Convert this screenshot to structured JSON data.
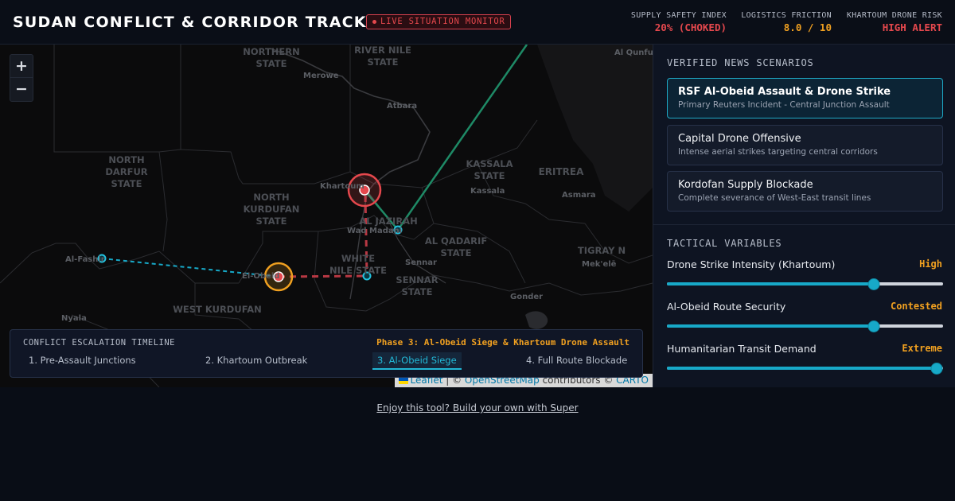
{
  "header": {
    "title": "SUDAN CONFLICT & CORRIDOR TRACKER",
    "badge": "LIVE SITUATION MONITOR",
    "metrics": [
      {
        "label": "SUPPLY SAFETY INDEX",
        "value": "20% (CHOKED)",
        "color": "#e5484d"
      },
      {
        "label": "LOGISTICS FRICTION",
        "value": "8.0 / 10",
        "color": "#f0a020"
      },
      {
        "label": "KHARTOUM DRONE RISK",
        "value": "HIGH ALERT",
        "color": "#e5484d"
      }
    ]
  },
  "map": {
    "zoom_in": "+",
    "zoom_out": "−",
    "region_labels": [
      "NORTHERN STATE",
      "RIVER NILE STATE",
      "NORTH DARFUR STATE",
      "NORTH KURDUFAN STATE",
      "KASSALA STATE",
      "ERITREA",
      "AL JAZIRAH",
      "AL QADARIF STATE",
      "WHITE NILE STATE",
      "SENNAR STATE",
      "TIGRAY N",
      "WEST KURDUFAN"
    ],
    "city_labels": [
      "Merowe",
      "Atbara",
      "Khartoum",
      "Kassala",
      "Asmara",
      "Wad Madani",
      "Sennar",
      "Al-Fashir",
      "El-Obeid",
      "Mek'elē",
      "Gonder",
      "Nyala",
      "Al Qunfudhah"
    ],
    "attribution": {
      "leaflet": "Leaflet",
      "sep": " | © ",
      "osm": "OpenStreetMap",
      "contrib": " contributors © ",
      "carto": "CARTO"
    }
  },
  "timeline": {
    "title": "CONFLICT ESCALATION TIMELINE",
    "phase": "Phase 3: Al-Obeid Siege & Khartoum Drone Assault",
    "steps": [
      "1. Pre-Assault Junctions",
      "2. Khartoum Outbreak",
      "3. Al-Obeid Siege",
      "4. Full Route Blockade"
    ],
    "active_step": 2
  },
  "panel": {
    "news_title": "VERIFIED NEWS SCENARIOS",
    "scenarios": [
      {
        "title": "RSF Al-Obeid Assault & Drone Strike",
        "subtitle": "Primary Reuters Incident - Central Junction Assault"
      },
      {
        "title": "Capital Drone Offensive",
        "subtitle": "Intense aerial strikes targeting central corridors"
      },
      {
        "title": "Kordofan Supply Blockade",
        "subtitle": "Complete severance of West-East transit lines"
      }
    ],
    "vars_title": "TACTICAL VARIABLES",
    "variables": [
      {
        "label": "Drone Strike Intensity (Khartoum)",
        "value": "High",
        "level": 0.75
      },
      {
        "label": "Al-Obeid Route Security",
        "value": "Contested",
        "level": 0.75
      },
      {
        "label": "Humanitarian Transit Demand",
        "value": "Extreme",
        "level": 1.0
      }
    ],
    "accent": "#f0a020"
  },
  "footer": {
    "link": "Enjoy this tool? Build your own with Super"
  }
}
